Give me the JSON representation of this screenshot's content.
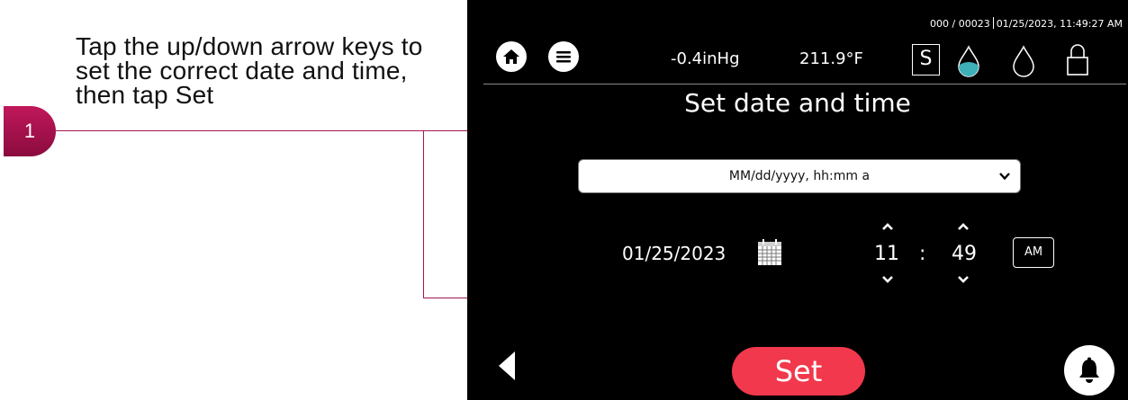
{
  "instruction": {
    "lines": [
      "Tap the up/down arrow keys to",
      "set the correct date and time,",
      "then tap Set"
    ],
    "step_number": "1"
  },
  "header": {
    "status": {
      "id_text": "000 / 00023",
      "datetime": "01/25/2023, 11:49:27 AM"
    },
    "pressure": "-0.4inHg",
    "temperature": "211.9°F",
    "s_label": "S",
    "icons": [
      "home-icon",
      "menu-icon",
      "water-drop-filled-icon",
      "water-drop-outline-icon",
      "lock-icon"
    ]
  },
  "screen_title": "Set date and time",
  "format_select": {
    "selected": "MM/dd/yyyy, hh:mm a"
  },
  "date_time": {
    "date": "01/25/2023",
    "hour": "11",
    "separator": ":",
    "minute": "49",
    "ampm": "AM"
  },
  "footer": {
    "set_label": "Set",
    "icons": [
      "back-arrow-icon",
      "bell-icon"
    ]
  },
  "colors": {
    "accent": "#a31552",
    "set_button": "#f2384c",
    "drop_fill": "#3fb0b8",
    "screen_bg": "#000000"
  }
}
